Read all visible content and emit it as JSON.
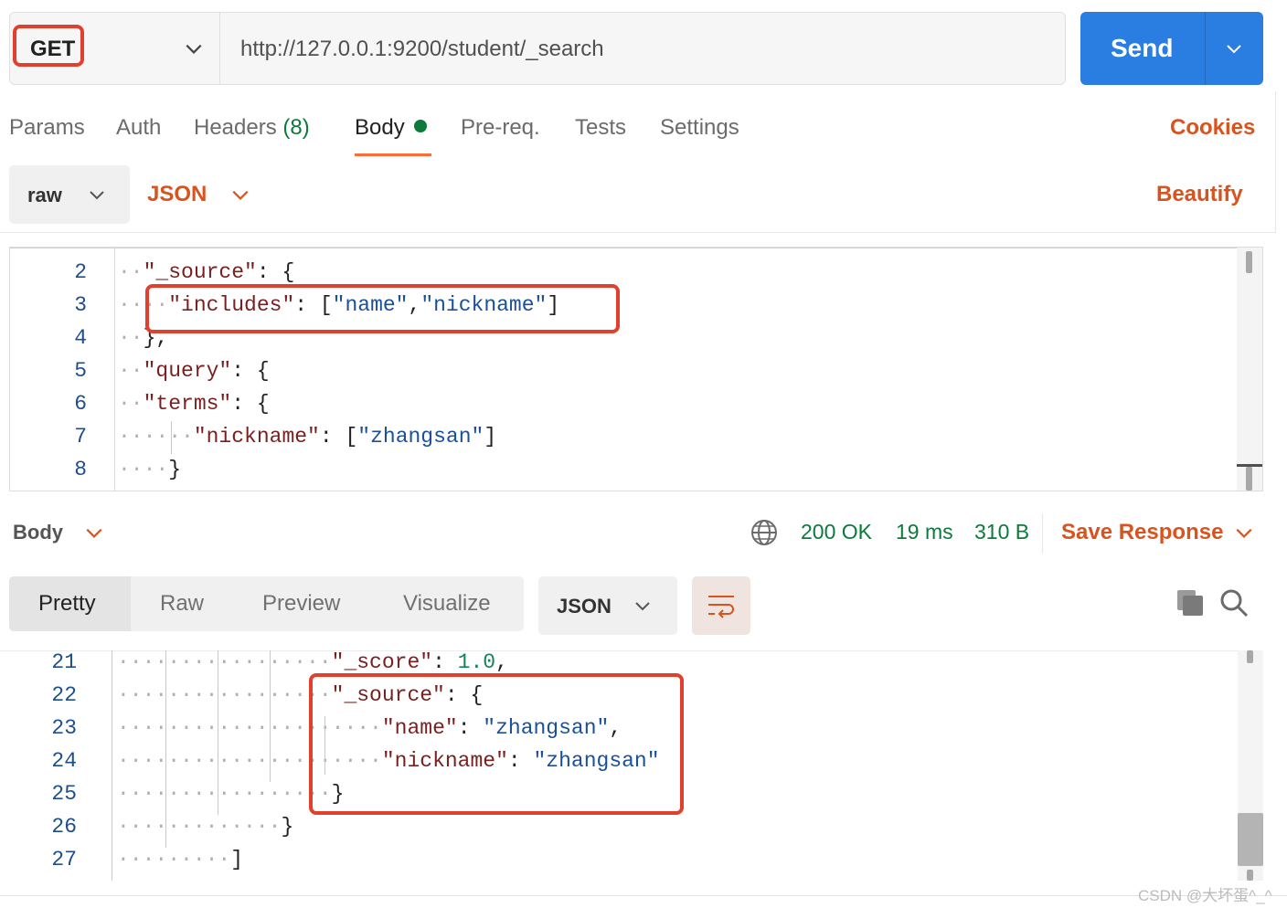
{
  "request": {
    "method": "GET",
    "url": "http://127.0.0.1:9200/student/_search",
    "send_label": "Send"
  },
  "tabs": {
    "params": "Params",
    "auth": "Auth",
    "headers": "Headers",
    "headers_count": "(8)",
    "body": "Body",
    "prereq": "Pre-req.",
    "tests": "Tests",
    "settings": "Settings",
    "cookies": "Cookies"
  },
  "body_options": {
    "mode": "raw",
    "language": "JSON",
    "beautify": "Beautify"
  },
  "request_editor": {
    "line_numbers": [
      "2",
      "3",
      "4",
      "5",
      "6",
      "7",
      "8"
    ]
  },
  "response": {
    "body_label": "Body",
    "status": "200 OK",
    "time": "19 ms",
    "size": "310 B",
    "save_label": "Save Response",
    "view_tabs": [
      "Pretty",
      "Raw",
      "Preview",
      "Visualize"
    ],
    "format": "JSON",
    "line_numbers": [
      "21",
      "22",
      "23",
      "24",
      "25",
      "26",
      "27"
    ]
  },
  "watermark": "CSDN @大坏蛋^_^",
  "colors": {
    "accent": "#ff6c37",
    "send": "#2a7de1",
    "link": "#d9531e",
    "status_ok": "#0c7a3a",
    "highlight_box": "#e2402e"
  },
  "icons": [
    "chevron-down-icon",
    "globe-icon",
    "wrap-lines-icon",
    "copy-icon",
    "search-icon"
  ]
}
